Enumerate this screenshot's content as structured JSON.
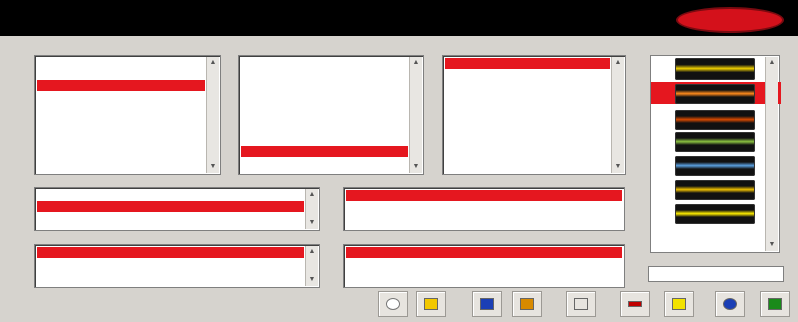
{
  "window": {
    "title": "",
    "subtitle": ""
  },
  "brand": {
    "logo_text": "",
    "accent_color": "#e5171f",
    "header_color": "#000000"
  },
  "manufacturer": {
    "label": "",
    "items": [
      {
        "label": "",
        "selected": false
      },
      {
        "label": "",
        "selected": false
      },
      {
        "label": "",
        "selected": true
      },
      {
        "label": "",
        "selected": false
      },
      {
        "label": "",
        "selected": false
      },
      {
        "label": "",
        "selected": false
      },
      {
        "label": "",
        "selected": false
      },
      {
        "label": "",
        "selected": false
      },
      {
        "label": "",
        "selected": false
      },
      {
        "label": "",
        "selected": false
      }
    ]
  },
  "model": {
    "label": "",
    "items": [
      {
        "label": "",
        "selected": false
      },
      {
        "label": "",
        "selected": false
      },
      {
        "label": "",
        "selected": false
      },
      {
        "label": "",
        "selected": false
      },
      {
        "label": "",
        "selected": false
      },
      {
        "label": "",
        "selected": false
      },
      {
        "label": "",
        "selected": false
      },
      {
        "label": "",
        "selected": false
      },
      {
        "label": "",
        "selected": true
      },
      {
        "label": "",
        "selected": false
      },
      {
        "label": "",
        "selected": false
      },
      {
        "label": "",
        "selected": false
      }
    ]
  },
  "year": {
    "label": "",
    "items": [
      {
        "label": "",
        "selected": true
      },
      {
        "label": "",
        "selected": false
      },
      {
        "label": "",
        "selected": false
      },
      {
        "label": "",
        "selected": false
      }
    ]
  },
  "engine_code": {
    "label": "",
    "items": [
      {
        "label": "",
        "selected": false
      },
      {
        "label": "",
        "selected": true
      }
    ]
  },
  "engine": {
    "label": "",
    "items": [
      {
        "label": "",
        "selected": true
      },
      {
        "label": "",
        "selected": false
      }
    ]
  },
  "control_unit": {
    "label": "",
    "value": ""
  },
  "diagnostics": {
    "label": "",
    "value": ""
  },
  "system_view": {
    "label": "",
    "panel_colors": [
      "#f0d000",
      "#ff8a1c",
      "#d94a00",
      "#8ac040",
      "#5aa0e0",
      "#f0c000",
      "#ffee00"
    ]
  },
  "epoch": {
    "label": "",
    "value": ""
  },
  "toolbar": {
    "buttons": [
      {
        "icon": "circle-icon",
        "color": "#ffffff"
      },
      {
        "icon": "pencil-icon",
        "color": "#f2c800"
      },
      {
        "icon": "monitor-icon",
        "color": "#1b3fb5"
      },
      {
        "icon": "copy-icon",
        "color": "#d88a00"
      },
      {
        "icon": "blank-icon",
        "color": "#e7e4df"
      },
      {
        "icon": "minus-icon",
        "color": "#c00000"
      },
      {
        "icon": "folder-icon",
        "color": "#f2e200"
      },
      {
        "icon": "info-icon",
        "color": "#1b3fb5"
      },
      {
        "icon": "next-icon",
        "color": "#1a8a1a"
      }
    ]
  }
}
